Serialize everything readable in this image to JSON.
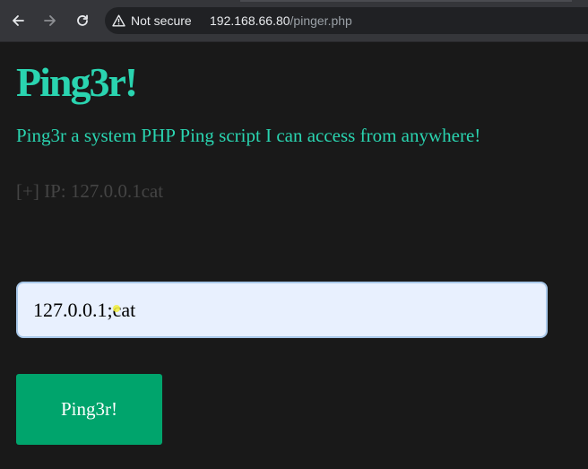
{
  "browser": {
    "back_icon": "arrow-left-icon",
    "forward_icon": "arrow-right-icon",
    "reload_icon": "reload-icon",
    "security_icon": "warning-triangle-icon",
    "security_label": "Not secure",
    "url_host": "192.168.66.80",
    "url_path": "/pinger.php"
  },
  "page": {
    "heading": "Ping3r!",
    "subtitle": "Ping3r a system PHP Ping script I can access from anywhere!",
    "result": "[+] IP: 127.0.0.1cat",
    "ip_input_value": "127.0.0.1;cat",
    "submit_label": "Ping3r!"
  },
  "colors": {
    "background": "#191919",
    "accent_text": "#2ad4b0",
    "button": "#00a46c",
    "input_background": "#e8f0fe",
    "result_text": "#444444"
  }
}
